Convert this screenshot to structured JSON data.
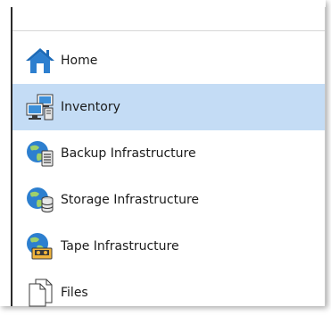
{
  "nav": {
    "selected_index": 1,
    "items": [
      {
        "label": "Home",
        "icon": "home-icon"
      },
      {
        "label": "Inventory",
        "icon": "inventory-icon"
      },
      {
        "label": "Backup Infrastructure",
        "icon": "backup-infrastructure-icon"
      },
      {
        "label": "Storage Infrastructure",
        "icon": "storage-infrastructure-icon"
      },
      {
        "label": "Tape Infrastructure",
        "icon": "tape-infrastructure-icon"
      },
      {
        "label": "Files",
        "icon": "files-icon"
      }
    ]
  },
  "colors": {
    "selected_background": "#c4dcf5",
    "accent_blue": "#1e6bb8",
    "text": "#1a1a1a"
  }
}
